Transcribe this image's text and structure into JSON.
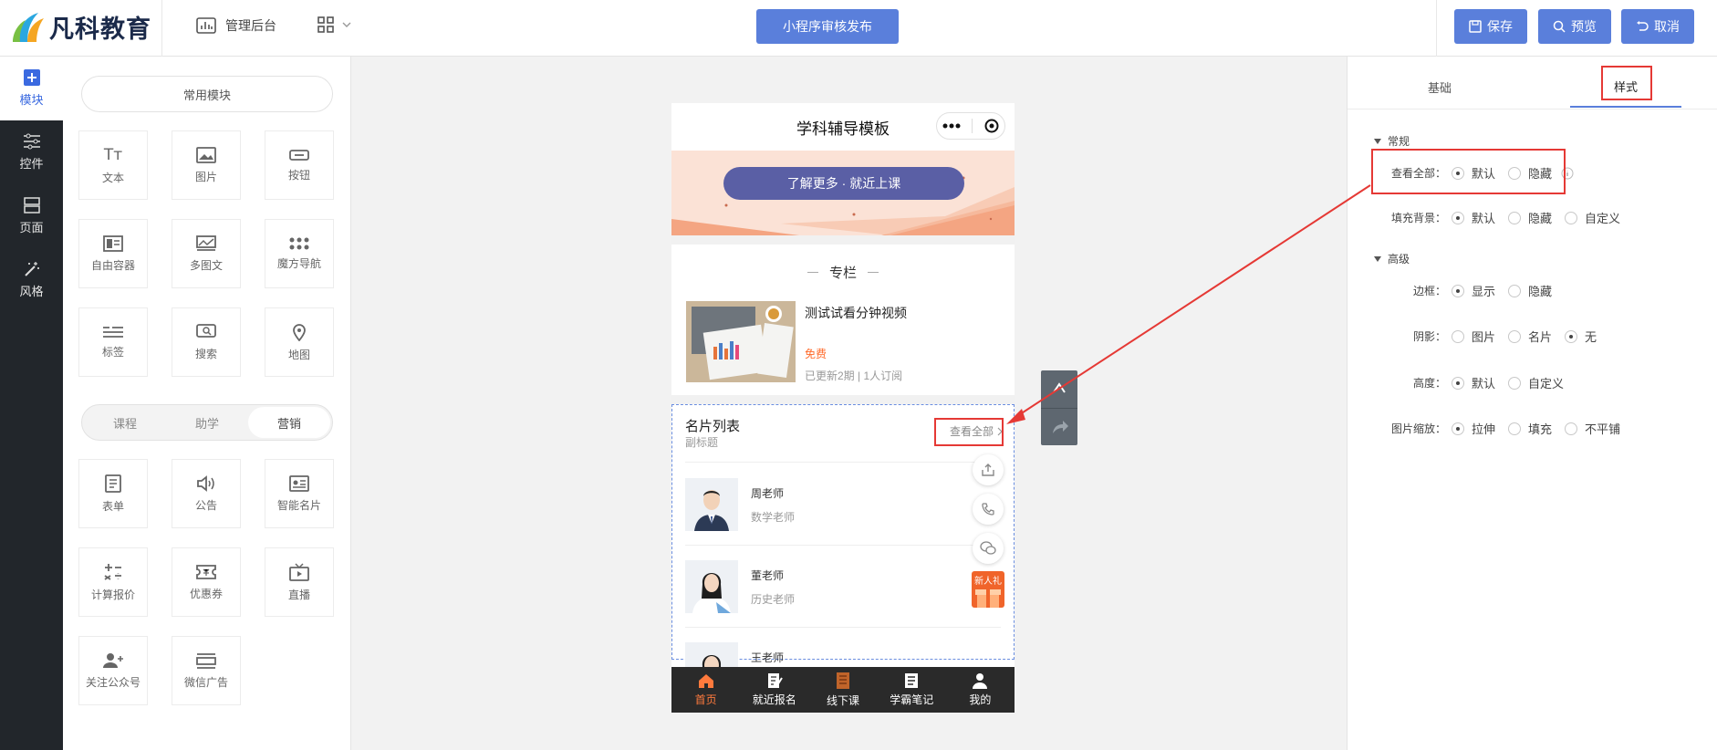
{
  "brand": {
    "name": "凡科教育"
  },
  "topbar": {
    "admin_label": "管理后台",
    "publish_label": "小程序审核发布",
    "save_label": "保存",
    "preview_label": "预览",
    "cancel_label": "取消"
  },
  "sidebar": {
    "items": [
      {
        "label": "模块",
        "icon": "plus-square-icon",
        "active": true
      },
      {
        "label": "控件",
        "icon": "sliders-icon"
      },
      {
        "label": "页面",
        "icon": "page-icon"
      },
      {
        "label": "风格",
        "icon": "magic-wand-icon"
      }
    ]
  },
  "modules": {
    "common_label": "常用模块",
    "common": [
      {
        "label": "文本",
        "icon": "text-icon"
      },
      {
        "label": "图片",
        "icon": "image-icon"
      },
      {
        "label": "按钮",
        "icon": "button-icon"
      },
      {
        "label": "自由容器",
        "icon": "container-icon"
      },
      {
        "label": "多图文",
        "icon": "multi-image-icon"
      },
      {
        "label": "魔方导航",
        "icon": "dots-grid-icon"
      },
      {
        "label": "标签",
        "icon": "tag-icon"
      },
      {
        "label": "搜索",
        "icon": "search-icon"
      },
      {
        "label": "地图",
        "icon": "map-pin-icon"
      }
    ],
    "tabs": [
      "课程",
      "助学",
      "营销"
    ],
    "active_tab": "营销",
    "marketing": [
      {
        "label": "表单",
        "icon": "form-icon"
      },
      {
        "label": "公告",
        "icon": "speaker-icon"
      },
      {
        "label": "智能名片",
        "icon": "card-icon"
      },
      {
        "label": "计算报价",
        "icon": "calculator-icon"
      },
      {
        "label": "优惠券",
        "icon": "coupon-icon"
      },
      {
        "label": "直播",
        "icon": "tv-icon"
      },
      {
        "label": "关注公众号",
        "icon": "user-add-icon"
      },
      {
        "label": "微信广告",
        "icon": "ad-icon"
      }
    ]
  },
  "phone": {
    "title": "学科辅导模板",
    "banner_button": "了解更多 · 就近上课",
    "column_title": "专栏",
    "course": {
      "title": "测试试看分钟视频",
      "price": "免费",
      "meta": "已更新2期 | 1人订阅"
    },
    "cards": {
      "title": "名片列表",
      "subtitle": "副标题",
      "view_all": "查看全部",
      "teachers": [
        {
          "name": "周老师",
          "desc": "数学老师"
        },
        {
          "name": "董老师",
          "desc": "历史老师"
        },
        {
          "name": "王老师",
          "desc": ""
        }
      ]
    },
    "gift_label": "新人礼",
    "tabbar": [
      {
        "label": "首页",
        "icon": "home-icon",
        "active": true
      },
      {
        "label": "就近报名",
        "icon": "sign-up-icon"
      },
      {
        "label": "线下课",
        "icon": "class-icon"
      },
      {
        "label": "学霸笔记",
        "icon": "note-icon"
      },
      {
        "label": "我的",
        "icon": "user-icon"
      }
    ]
  },
  "settings": {
    "tabs": [
      "基础",
      "样式"
    ],
    "active_tab": "样式",
    "general_label": "常规",
    "advanced_label": "高级",
    "rows": {
      "view_all": {
        "label": "查看全部：",
        "options": [
          "默认",
          "隐藏"
        ],
        "selected": "默认"
      },
      "fill_bg": {
        "label": "填充背景：",
        "options": [
          "默认",
          "隐藏",
          "自定义"
        ],
        "selected": "默认"
      },
      "border": {
        "label": "边框：",
        "options": [
          "显示",
          "隐藏"
        ],
        "selected": "显示"
      },
      "shadow": {
        "label": "阴影：",
        "options": [
          "图片",
          "名片",
          "无"
        ],
        "selected": "无"
      },
      "height": {
        "label": "高度：",
        "options": [
          "默认",
          "自定义"
        ],
        "selected": "默认"
      },
      "scale": {
        "label": "图片缩放：",
        "options": [
          "拉伸",
          "填充",
          "不平铺"
        ],
        "selected": "拉伸"
      }
    }
  },
  "colors": {
    "accent": "#5a7fdb",
    "highlight": "#e53935",
    "tab_active": "#ff7a3d"
  }
}
